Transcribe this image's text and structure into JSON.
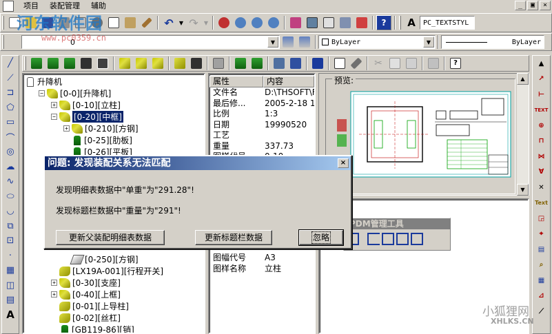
{
  "menubar": {
    "items": [
      "项目",
      "装配管理",
      "辅助"
    ],
    "window_controls": [
      "_",
      "▣",
      "×"
    ]
  },
  "toolbar1": {
    "text_style_value": "PC_TEXTSTYL"
  },
  "toolbar2": {
    "layer_value": "0",
    "color_value": "ByLayer",
    "linetype_value": "ByLayer"
  },
  "tree": {
    "nodes": [
      {
        "label": "升降机",
        "level": 0,
        "icon": "root-icon",
        "expander": ""
      },
      {
        "label": "[0-0][升降机]",
        "level": 1,
        "icon": "assembly-icon",
        "expander": "−"
      },
      {
        "label": "[0-10][立柱]",
        "level": 2,
        "icon": "assembly-icon",
        "expander": "+"
      },
      {
        "label": "[0-20][中框]",
        "level": 2,
        "icon": "assembly-icon",
        "expander": "−",
        "selected": true
      },
      {
        "label": "[0-210][方钢]",
        "level": 3,
        "icon": "assembly-icon",
        "expander": "+"
      },
      {
        "label": "[0-25][肋板]",
        "level": 3,
        "icon": "part-icon",
        "expander": ""
      },
      {
        "label": "[0-26][平板]",
        "level": 3,
        "icon": "part-icon",
        "expander": ""
      },
      {
        "label": "[0-250][方钢]",
        "level": 3,
        "icon": "pen-icon",
        "expander": ""
      },
      {
        "label": "[LX19A-001][行程开关]",
        "level": 2,
        "icon": "pin-icon",
        "expander": ""
      },
      {
        "label": "[0-30][支座]",
        "level": 2,
        "icon": "assembly-icon",
        "expander": "+"
      },
      {
        "label": "[0-40][上框]",
        "level": 2,
        "icon": "assembly-icon",
        "expander": "+"
      },
      {
        "label": "[0-01][上导柱]",
        "level": 2,
        "icon": "pin-icon",
        "expander": ""
      },
      {
        "label": "[0-02][丝杠]",
        "level": 2,
        "icon": "pin-icon",
        "expander": ""
      },
      {
        "label": "[GB119-86][销]",
        "level": 2,
        "icon": "part-icon",
        "expander": ""
      }
    ]
  },
  "props": {
    "header_key": "属性",
    "header_value": "内容",
    "rows_top": [
      {
        "k": "文件名",
        "v": "D:\\THSOFT\\F"
      },
      {
        "k": "最后修...",
        "v": "2005-2-18 1("
      },
      {
        "k": "比例",
        "v": "1:3"
      },
      {
        "k": "日期",
        "v": "19990520"
      },
      {
        "k": "工艺",
        "v": ""
      },
      {
        "k": "重量",
        "v": "337.73"
      },
      {
        "k": "图样代号",
        "v": "0-10"
      }
    ],
    "rows_bottom": [
      {
        "k": "图幅代号",
        "v": "A3"
      },
      {
        "k": "图样名称",
        "v": "立柱"
      }
    ]
  },
  "preview": {
    "label": "预览:"
  },
  "pdm_toolbar": {
    "title": "PDM管理工具"
  },
  "dialog": {
    "title": "问题: 发现装配关系无法匹配",
    "message1": "发现明细表数据中\"单重\"为\"291.28\"!",
    "message2": "发现标题栏数据中\"重量\"为\"291\"!",
    "btn_update_parent": "更新父装配明细表数据",
    "btn_update_title": "更新标题栏数据",
    "btn_ignore": "忽略"
  },
  "watermarks": {
    "site_name": "河东软件园",
    "site_url": "www.pc0359.cn",
    "site2_name": "小狐狸网",
    "site2_url": "XHLKS.CN"
  }
}
